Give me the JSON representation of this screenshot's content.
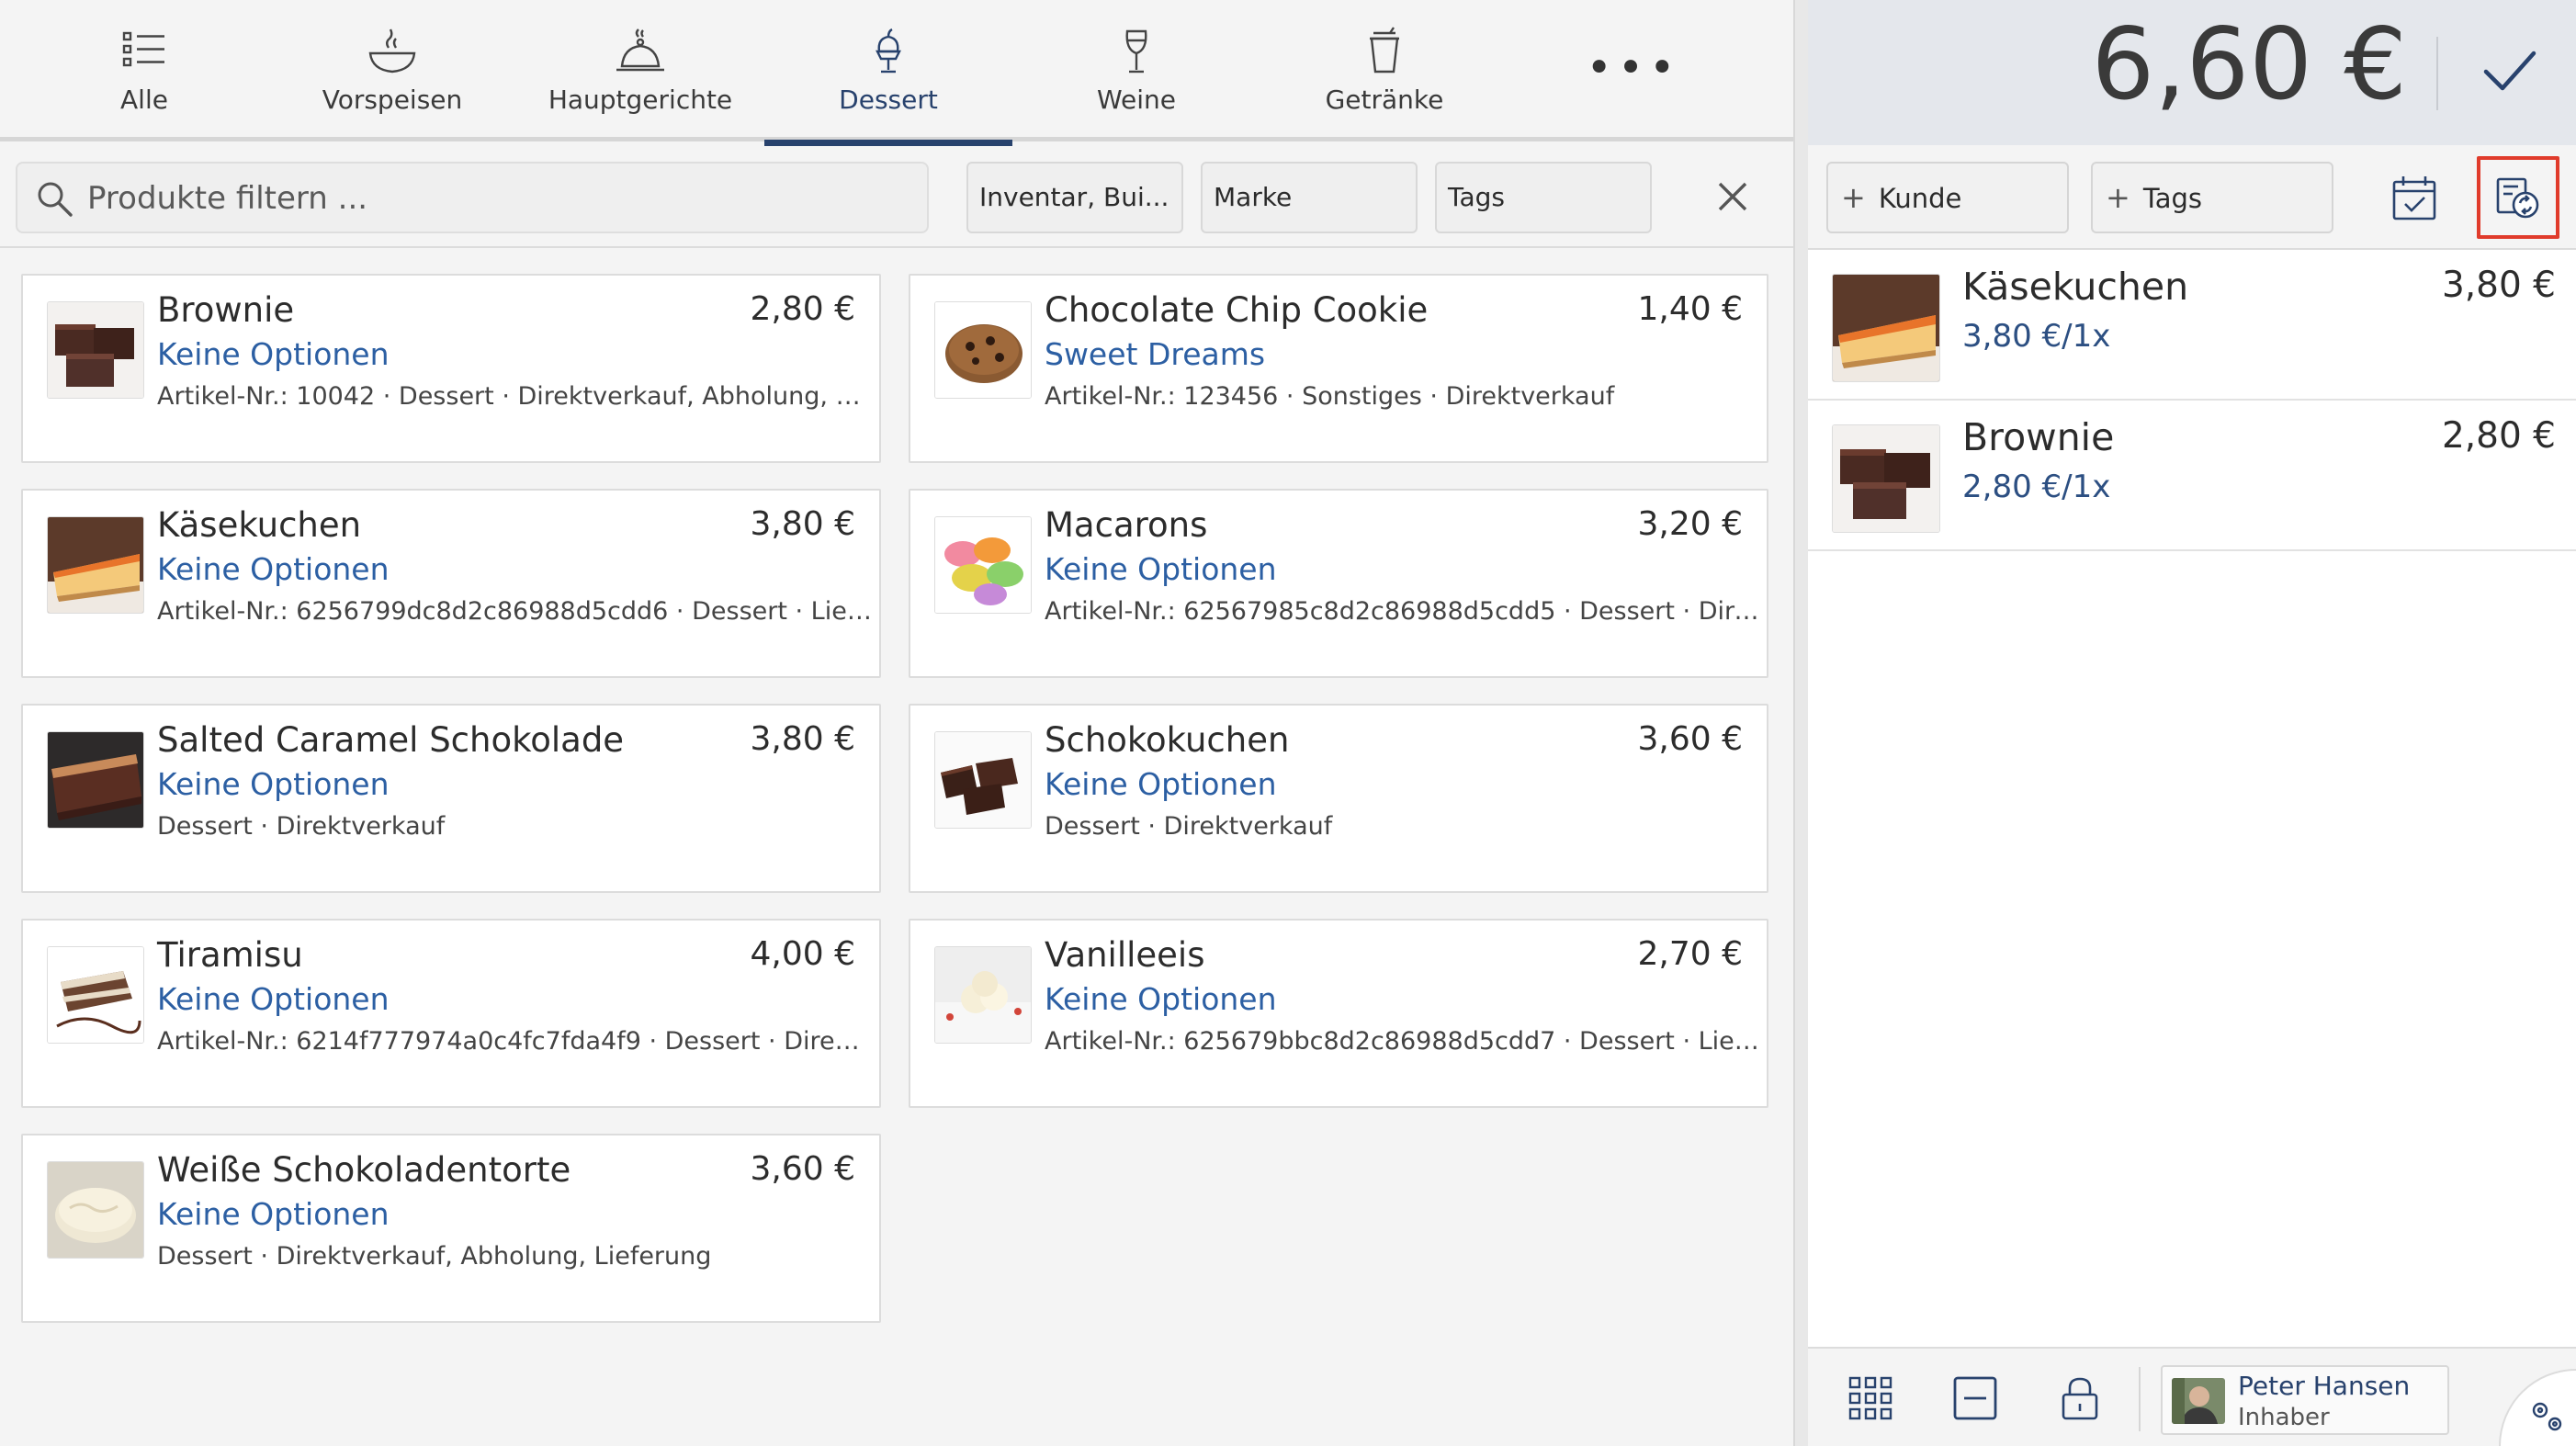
{
  "tabs": [
    {
      "label": "Alle",
      "icon": "list-icon"
    },
    {
      "label": "Vorspeisen",
      "icon": "bowl-icon"
    },
    {
      "label": "Hauptgerichte",
      "icon": "cloche-icon"
    },
    {
      "label": "Dessert",
      "icon": "ice-cream-icon",
      "active": true
    },
    {
      "label": "Weine",
      "icon": "wine-glass-icon"
    },
    {
      "label": "Getränke",
      "icon": "cup-icon"
    }
  ],
  "more_label": "•••",
  "filter": {
    "placeholder": "Produkte filtern ...",
    "inventory_label": "Inventar, Bui...",
    "brand_label": "Marke",
    "tags_label": "Tags"
  },
  "products": [
    {
      "name": "Brownie",
      "price": "2,80 €",
      "option": "Keine Optionen",
      "meta": "Artikel-Nr.: 10042 · Dessert · Direktverkauf, Abholung, Liefe...",
      "img": "brownie"
    },
    {
      "name": "Chocolate Chip Cookie",
      "price": "1,40 €",
      "option": "Sweet Dreams",
      "meta": "Artikel-Nr.: 123456 · Sonstiges · Direktverkauf",
      "img": "cookie"
    },
    {
      "name": "Käsekuchen",
      "price": "3,80 €",
      "option": "Keine Optionen",
      "meta": "Artikel-Nr.: 6256799dc8d2c86988d5cdd6 · Dessert · Lieferu...",
      "img": "cheesecake"
    },
    {
      "name": "Macarons",
      "price": "3,20 €",
      "option": "Keine Optionen",
      "meta": "Artikel-Nr.: 62567985c8d2c86988d5cdd5 · Dessert · Direktv...",
      "img": "macarons"
    },
    {
      "name": "Salted Caramel Schokolade",
      "price": "3,80 €",
      "option": "Keine Optionen",
      "meta": "Dessert · Direktverkauf",
      "img": "caramel"
    },
    {
      "name": "Schokokuchen",
      "price": "3,60 €",
      "option": "Keine Optionen",
      "meta": "Dessert · Direktverkauf",
      "img": "chococake"
    },
    {
      "name": "Tiramisu",
      "price": "4,00 €",
      "option": "Keine Optionen",
      "meta": "Artikel-Nr.: 6214f777974a0c4fc7fda4f9 · Dessert · Direktver...",
      "img": "tiramisu"
    },
    {
      "name": "Vanilleeis",
      "price": "2,70 €",
      "option": "Keine Optionen",
      "meta": "Artikel-Nr.: 625679bbc8d2c86988d5cdd7 · Dessert · Lieferu...",
      "img": "vanilla"
    },
    {
      "name": "Weiße Schokoladentorte",
      "price": "3,60 €",
      "option": "Keine Optionen",
      "meta": "Dessert · Direktverkauf, Abholung, Lieferung",
      "img": "whitecake"
    }
  ],
  "cart": {
    "total": "6,60 €",
    "customer_label": "Kunde",
    "tags_label": "Tags",
    "items": [
      {
        "name": "Käsekuchen",
        "unit": "3,80 €/1x",
        "amount": "3,80 €",
        "img": "cheesecake"
      },
      {
        "name": "Brownie",
        "unit": "2,80 €/1x",
        "amount": "2,80 €",
        "img": "brownie"
      }
    ]
  },
  "user": {
    "name": "Peter Hansen",
    "role": "Inhaber"
  },
  "colors": {
    "accent": "#28426d",
    "link": "#2c5fa3",
    "highlight": "#e03b2b"
  }
}
